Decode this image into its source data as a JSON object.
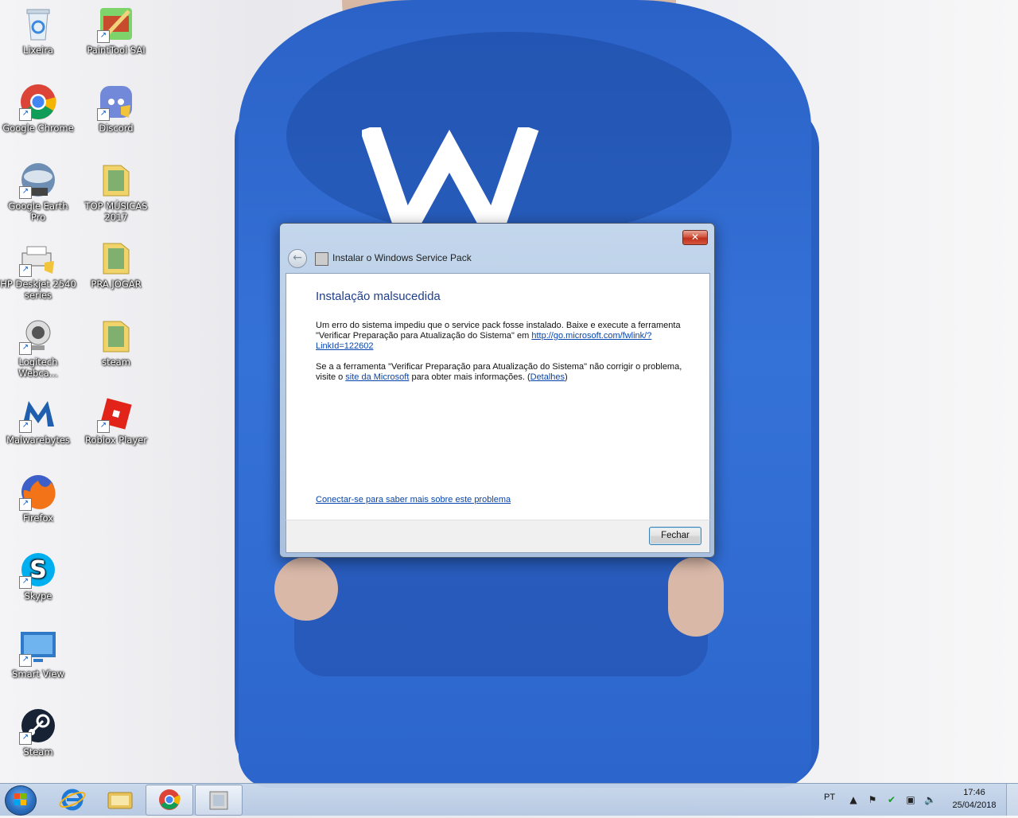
{
  "desktop": {
    "icons": [
      {
        "label": "Lixeira",
        "icon": "recycle-bin-icon",
        "shortcut": false
      },
      {
        "label": "PaintTool SAI",
        "icon": "painttool-sai-icon",
        "shortcut": true
      },
      {
        "label": "Google Chrome",
        "icon": "chrome-icon",
        "shortcut": true
      },
      {
        "label": "Discord",
        "icon": "discord-icon",
        "shortcut": true
      },
      {
        "label": "Google Earth Pro",
        "icon": "google-earth-icon",
        "shortcut": true
      },
      {
        "label": "TOP MÚSICAS 2017",
        "icon": "folder-icon",
        "shortcut": false
      },
      {
        "label": "HP Deskjet 2540 series",
        "icon": "printer-icon",
        "shortcut": true
      },
      {
        "label": "PRA JOGAR",
        "icon": "folder-icon",
        "shortcut": false
      },
      {
        "label": "Logitech Webca...",
        "icon": "webcam-icon",
        "shortcut": true
      },
      {
        "label": "steam",
        "icon": "folder-icon",
        "shortcut": false
      },
      {
        "label": "Malwarebytes",
        "icon": "malwarebytes-icon",
        "shortcut": true
      },
      {
        "label": "Roblox Player",
        "icon": "roblox-icon",
        "shortcut": true
      },
      {
        "label": "Firefox",
        "icon": "firefox-icon",
        "shortcut": true
      },
      {
        "label": "Skype",
        "icon": "skype-icon",
        "shortcut": true
      },
      {
        "label": "Smart View",
        "icon": "smart-view-icon",
        "shortcut": true
      },
      {
        "label": "Steam",
        "icon": "steam-icon",
        "shortcut": true
      }
    ]
  },
  "dialog": {
    "title": "Instalar o Windows Service Pack",
    "close_glyph": "✕",
    "heading": "Instalação malsucedida",
    "p1_text": "Um erro do sistema impediu que o service pack fosse instalado. Baixe e execute a ferramenta \"Verificar Preparação para Atualização do Sistema\" em ",
    "p1_link": "http://go.microsoft.com/fwlink/?LinkId=122602",
    "p2_text_a": "Se a a ferramenta \"Verificar Preparação para Atualização do Sistema\" não corrigir o problema, visite o ",
    "p2_link1": "site da Microsoft",
    "p2_text_b": " para obter mais informações. (",
    "p2_link2": "Detalhes",
    "p2_text_c": ")",
    "more_link": "Conectar-se para saber mais sobre este problema",
    "close_button": "Fechar"
  },
  "taskbar": {
    "language": "PT",
    "time": "17:46",
    "date": "25/04/2018"
  },
  "colors": {
    "heading": "#1f3f8c",
    "link": "#0645ad"
  }
}
